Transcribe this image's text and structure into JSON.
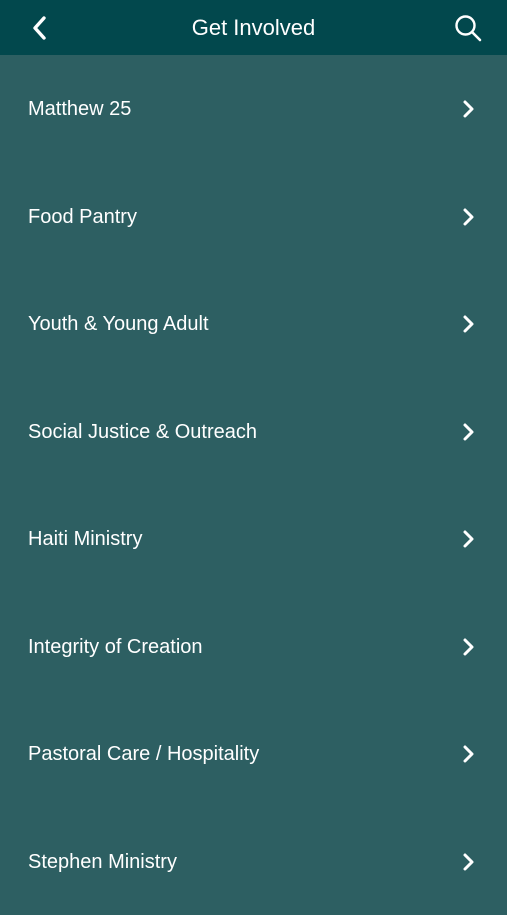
{
  "header": {
    "title": "Get Involved",
    "back_icon": "chevron-left-icon",
    "search_icon": "search-icon",
    "background_color": "#02484d"
  },
  "list": {
    "background_color": "#2d5f62",
    "items": [
      {
        "label": "Matthew 25"
      },
      {
        "label": "Food Pantry"
      },
      {
        "label": "Youth & Young Adult"
      },
      {
        "label": "Social Justice & Outreach"
      },
      {
        "label": "Haiti Ministry"
      },
      {
        "label": "Integrity of Creation"
      },
      {
        "label": "Pastoral Care / Hospitality"
      },
      {
        "label": "Stephen Ministry"
      }
    ],
    "item_icon": "chevron-right-icon"
  }
}
